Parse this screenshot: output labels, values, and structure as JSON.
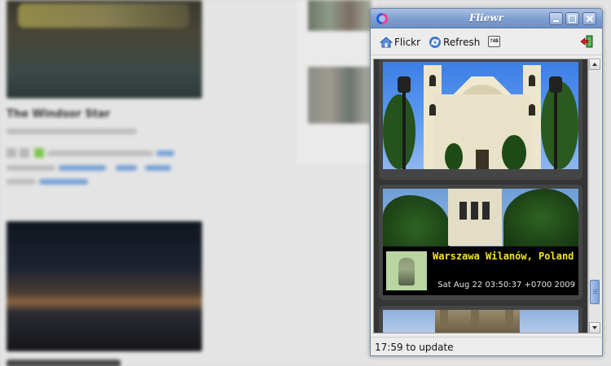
{
  "window": {
    "title": "Fliewr"
  },
  "toolbar": {
    "flickr_label": "Flickr",
    "refresh_label": "Refresh",
    "about_icon_text": "?AB"
  },
  "feed": {
    "items": [
      {
        "kind": "photo",
        "subject": "church"
      },
      {
        "kind": "photo",
        "subject": "church tower",
        "title": "Warszawa Wilanów, Poland",
        "date": "Sat Aug 22 03:50:37 +0700 2009"
      },
      {
        "kind": "photo",
        "subject": "gothic church"
      }
    ]
  },
  "status": {
    "text": "17:59 to update"
  },
  "background_page": {
    "photo_title": "The Windsor Star"
  },
  "colors": {
    "titlebar": "#7f9fd0",
    "feed_background": "#353535",
    "caption_title": "#f2e61a"
  },
  "scroll": {
    "position_fraction": 0.72
  }
}
